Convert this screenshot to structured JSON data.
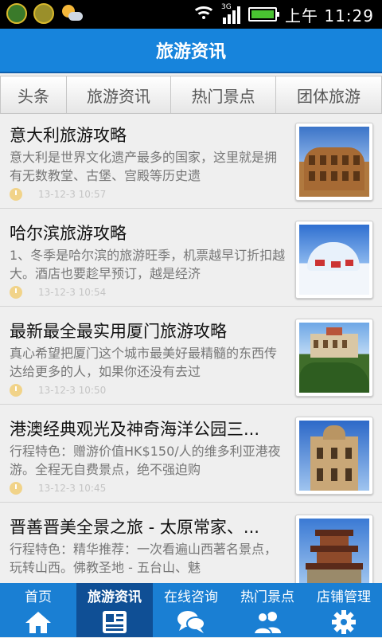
{
  "status_bar": {
    "network": "3G",
    "time": "上午 11:29"
  },
  "header": {
    "title": "旅游资讯"
  },
  "category_tabs": [
    "头条",
    "旅游资讯",
    "热门景点",
    "团体旅游"
  ],
  "articles": [
    {
      "title": "意大利旅游攻略",
      "summary": "意大利是世界文化遗产最多的国家，这里就是拥有无数教堂、古堡、宫殿等历史遗",
      "time": "13-12-3 10:57",
      "image_icon": "colosseum-photo"
    },
    {
      "title": "哈尔滨旅游攻略",
      "summary": "1、冬季是哈尔滨的旅游旺季，机票越早订折扣越大。酒店也要趁早预订，越是经济",
      "time": "13-12-3 10:54",
      "image_icon": "ice-sculpture-photo"
    },
    {
      "title": "最新最全最实用厦门旅游攻略",
      "summary": "真心希望把厦门这个城市最美好最精髓的东西传达给更多的人，如果你还没有去过",
      "time": "13-12-3 10:50",
      "image_icon": "xiamen-building-photo"
    },
    {
      "title": "港澳经典观光及神奇海洋公园三...",
      "summary": "行程特色：赠游价值HK$150/人的维多利亚港夜游。全程无自费景点，绝不强迫购",
      "time": "13-12-3 10:45",
      "image_icon": "macau-ruins-photo"
    },
    {
      "title": "晋善晋美全景之旅 - 太原常家、...",
      "summary": "行程特色：精华推荐：一次看遍山西著名景点，玩转山西。佛教圣地 - 五台山、魅",
      "time": "",
      "image_icon": "pagoda-photo"
    }
  ],
  "bottom_nav": [
    {
      "label": "首页",
      "icon": "home-icon"
    },
    {
      "label": "旅游资讯",
      "icon": "news-icon",
      "active": true
    },
    {
      "label": "在线咨询",
      "icon": "chat-icon"
    },
    {
      "label": "热门景点",
      "icon": "people-icon"
    },
    {
      "label": "店铺管理",
      "icon": "gear-icon"
    }
  ],
  "colors": {
    "title_bar": "#1784dc",
    "bottom_nav": "#1a7fd3",
    "bottom_nav_active": "#0f4f95"
  }
}
